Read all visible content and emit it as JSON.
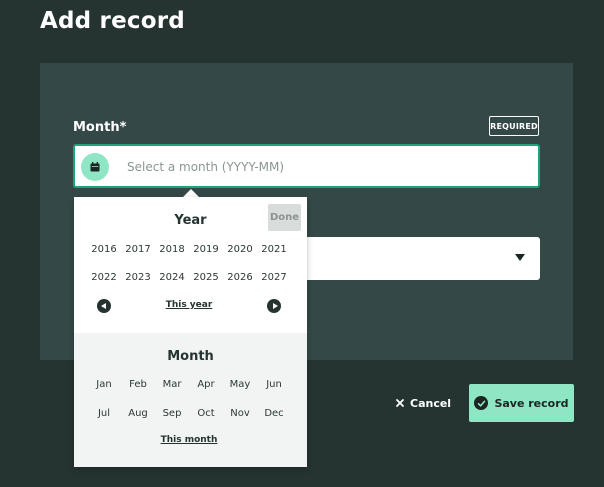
{
  "page": {
    "title": "Add record"
  },
  "form": {
    "month_label": "Month*",
    "required_badge": "REQUIRED",
    "month_placeholder": "Select a month (YYYY-MM)",
    "month_value": ""
  },
  "picker": {
    "done_label": "Done",
    "year_title": "Year",
    "years": [
      "2016",
      "2017",
      "2018",
      "2019",
      "2020",
      "2021",
      "2022",
      "2023",
      "2024",
      "2025",
      "2026",
      "2027"
    ],
    "this_year_label": "This year",
    "month_title": "Month",
    "months": [
      "Jan",
      "Feb",
      "Mar",
      "Apr",
      "May",
      "Jun",
      "Jul",
      "Aug",
      "Sep",
      "Oct",
      "Nov",
      "Dec"
    ],
    "this_month_label": "This month"
  },
  "actions": {
    "cancel_label": "Cancel",
    "save_label": "Save record"
  },
  "icons": {
    "calendar": "calendar-icon",
    "prev": "chevron-left-icon",
    "next": "chevron-right-icon",
    "close": "close-icon",
    "check": "check-circle-icon",
    "caret": "caret-down-icon"
  },
  "colors": {
    "background": "#253331",
    "panel": "#344947",
    "accent": "#8fe6c4",
    "focus_border": "#1fa37a"
  }
}
